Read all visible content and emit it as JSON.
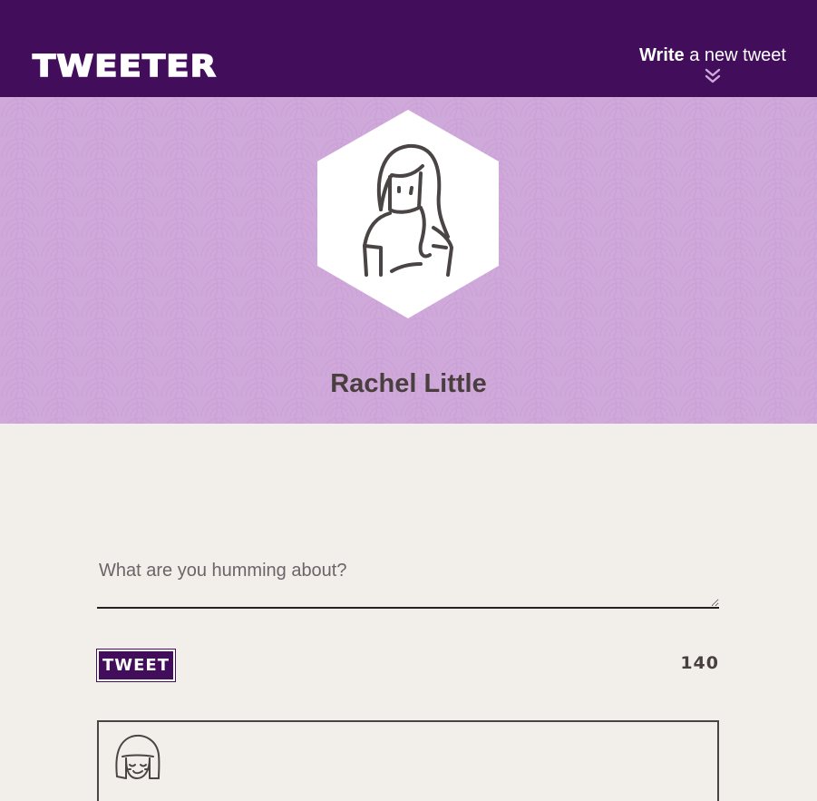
{
  "nav": {
    "logo": "TWEETER",
    "compose_toggle": {
      "bold": "Write",
      "rest": " a new tweet"
    }
  },
  "profile": {
    "name": "Rachel Little"
  },
  "compose": {
    "placeholder": "What are you humming about?",
    "button_label": "TWEET",
    "char_count": "140"
  },
  "colors": {
    "nav_bg": "#420e5b",
    "profile_bg": "#d0a9db",
    "page_bg": "#f2efea",
    "text_dark": "#4a3f3f",
    "chevron": "#d0a9db"
  },
  "icons": {
    "chevron": "double-chevron-down-icon",
    "avatar": "avatar-illustration",
    "tweet_avatar": "smiling-face-avatar-icon"
  }
}
